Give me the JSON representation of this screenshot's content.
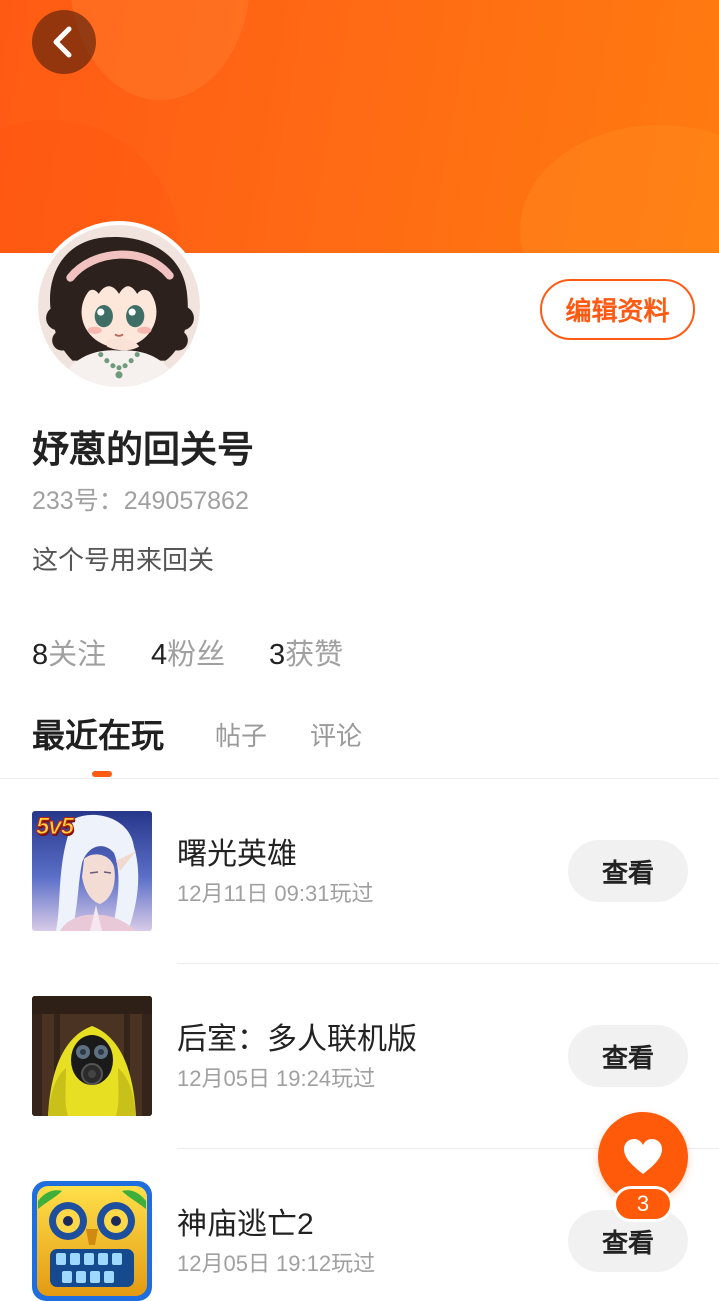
{
  "header": {
    "back_icon": "chevron-left-icon"
  },
  "profile": {
    "edit_label": "编辑资料",
    "name": "妤蒽的回关号",
    "id_text": "233号：249057862",
    "bio": "这个号用来回关"
  },
  "stats": [
    {
      "count": "8",
      "label": "关注"
    },
    {
      "count": "4",
      "label": "粉丝"
    },
    {
      "count": "3",
      "label": "获赞"
    }
  ],
  "tabs": [
    {
      "label": "最近在玩",
      "active": true
    },
    {
      "label": "帖子",
      "active": false
    },
    {
      "label": "评论",
      "active": false
    }
  ],
  "games": [
    {
      "title": "曙光英雄",
      "played": "12月11日 09:31玩过",
      "action": "查看",
      "logo_text": "5v5"
    },
    {
      "title": "后室：多人联机版",
      "played": "12月05日 19:24玩过",
      "action": "查看"
    },
    {
      "title": "神庙逃亡2",
      "played": "12月05日 19:12玩过",
      "action": "查看"
    }
  ],
  "fab": {
    "icon": "heart-icon",
    "count": "3"
  },
  "colors": {
    "accent": "#FF5A14",
    "header_start": "#FF5A14",
    "header_end": "#FF7B10",
    "text_primary": "#222222",
    "text_secondary": "#A0A0A0",
    "button_bg": "#F1F1F1"
  }
}
